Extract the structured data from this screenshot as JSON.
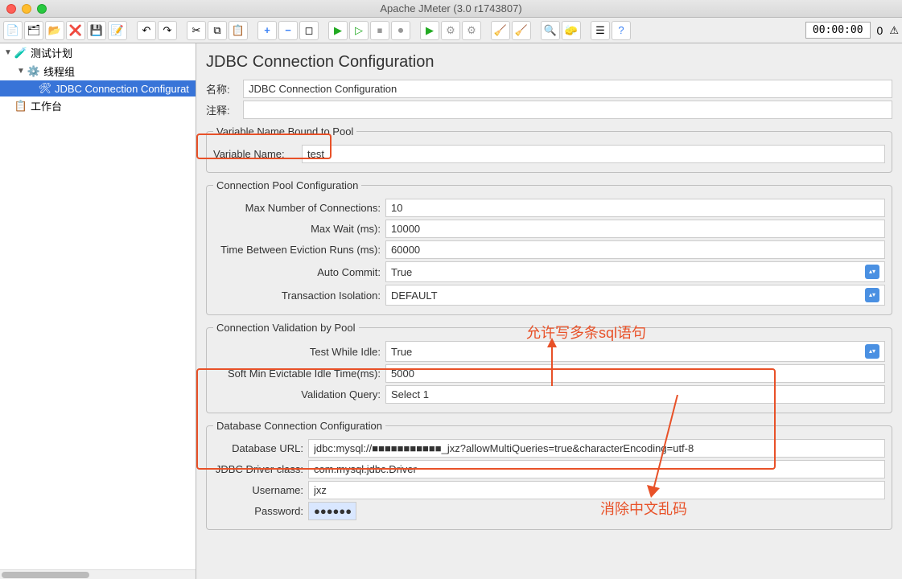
{
  "window": {
    "title": "Apache JMeter (3.0 r1743807)"
  },
  "toolbar": {
    "time": "00:00:00",
    "count": "0"
  },
  "tree": {
    "root_label": "测试计划",
    "thread_group_label": "线程组",
    "jdbc_config_label": "JDBC Connection Configurat",
    "workbench_label": "工作台"
  },
  "panel": {
    "title": "JDBC Connection Configuration",
    "name_label": "名称:",
    "name_value": "JDBC Connection Configuration",
    "comment_label": "注释:",
    "comment_value": ""
  },
  "var_pool": {
    "legend": "Variable Name Bound to Pool",
    "var_name_label": "Variable Name:",
    "var_name_value": "test"
  },
  "conn_pool": {
    "legend": "Connection Pool Configuration",
    "max_conn_label": "Max Number of Connections:",
    "max_conn_value": "10",
    "max_wait_label": "Max Wait (ms):",
    "max_wait_value": "10000",
    "eviction_label": "Time Between Eviction Runs (ms):",
    "eviction_value": "60000",
    "auto_commit_label": "Auto Commit:",
    "auto_commit_value": "True",
    "tx_iso_label": "Transaction Isolation:",
    "tx_iso_value": "DEFAULT"
  },
  "validation": {
    "legend": "Connection Validation by Pool",
    "test_idle_label": "Test While Idle:",
    "test_idle_value": "True",
    "soft_min_label": "Soft Min Evictable Idle Time(ms):",
    "soft_min_value": "5000",
    "validation_q_label": "Validation Query:",
    "validation_q_value": "Select 1"
  },
  "db_conn": {
    "legend": "Database Connection Configuration",
    "url_label": "Database URL:",
    "url_value": "jdbc:mysql://■■■■■■■■■■■_jxz?allowMultiQueries=true&characterEncoding=utf-8",
    "driver_label": "JDBC Driver class:",
    "driver_value": "com.mysql.jdbc.Driver",
    "user_label": "Username:",
    "user_value": "jxz",
    "pass_label": "Password:",
    "pass_value": "●●●●●●"
  },
  "annotations": {
    "anno1": "允许写多条sql语句",
    "anno2": "消除中文乱码"
  }
}
